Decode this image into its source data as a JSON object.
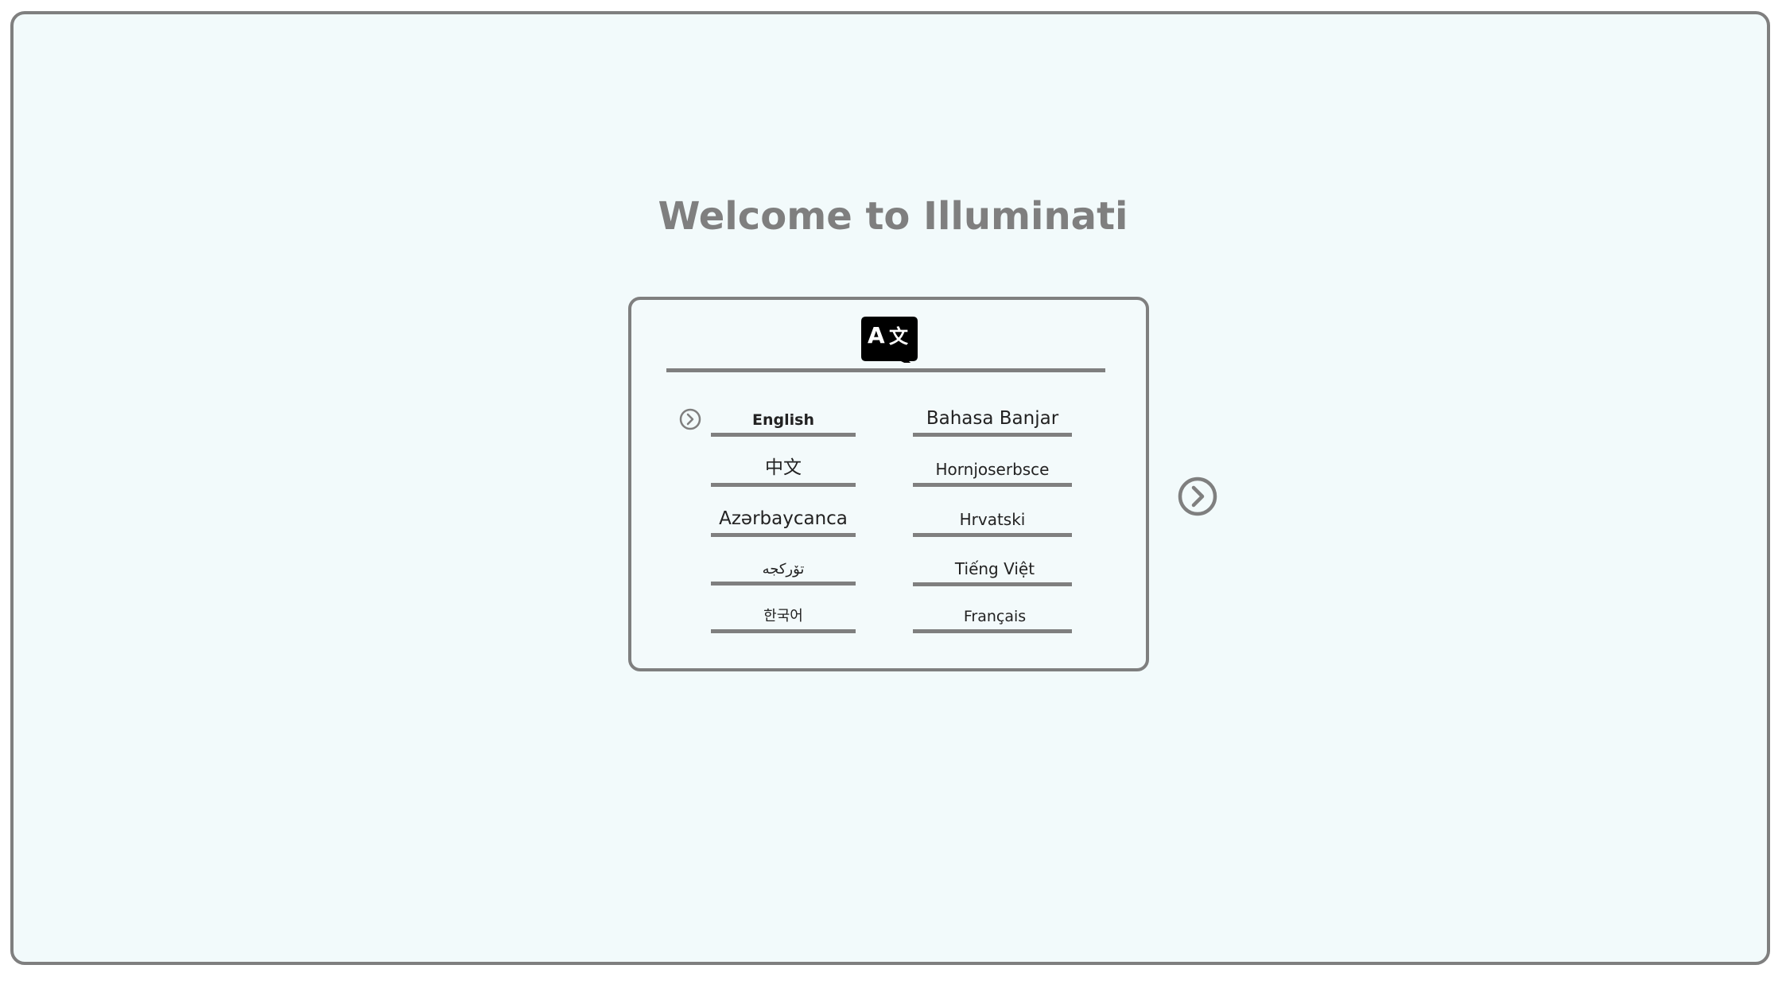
{
  "app": {
    "title": "Welcome to Illuminati"
  },
  "language_panel": {
    "header_icon": "translate-icon",
    "selected": "English",
    "languages_left": [
      {
        "label": "English"
      },
      {
        "label": "中文"
      },
      {
        "label": "Azərbaycanca"
      },
      {
        "label": "تۆرکجه"
      },
      {
        "label": "한국어"
      }
    ],
    "languages_right": [
      {
        "label": "Bahasa Banjar"
      },
      {
        "label": "Hornjoserbsce"
      },
      {
        "label": "Hrvatski"
      },
      {
        "label": "Tiếng Việt"
      },
      {
        "label": "Français"
      }
    ]
  },
  "icons": {
    "selected_marker": "chevron-right-circle-icon",
    "next": "chevron-right-circle-icon"
  },
  "colors": {
    "frame_border": "#7f7f7f",
    "background": "#f2fafb",
    "title": "#7f7f7f",
    "icon_fill": "#000000"
  }
}
